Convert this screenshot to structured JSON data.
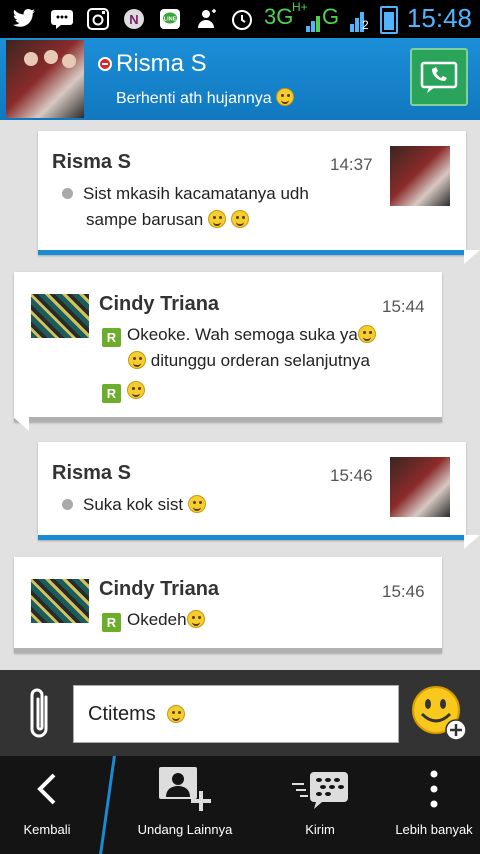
{
  "status_bar": {
    "network_3g": "3G",
    "network_hplus": "H+",
    "network_g": "G",
    "sim_number": "2",
    "time": "15:48",
    "icons": [
      "twitter-icon",
      "bbm-icon",
      "instagram-icon",
      "n-app-icon",
      "line-icon",
      "add-person-icon",
      "alarm-icon",
      "signal-icon",
      "battery-icon"
    ]
  },
  "header": {
    "contact_name": "Risma S",
    "status_message": "Berhenti ath hujannya",
    "presence": "busy",
    "call_button": "call-icon"
  },
  "messages": [
    {
      "sender": "Risma S",
      "time": "14:37",
      "side": "mine",
      "lines": [
        "Sist mkasih kacamatanya udh",
        "sampe barusan"
      ]
    },
    {
      "sender": "Cindy Triana",
      "time": "15:44",
      "side": "theirs",
      "lines": [
        "Okeoke. Wah semoga suka ya",
        "ditunggu orderan selanjutnya"
      ]
    },
    {
      "sender": "Risma S",
      "time": "15:46",
      "side": "mine",
      "lines": [
        "Suka kok sist"
      ]
    },
    {
      "sender": "Cindy Triana",
      "time": "15:46",
      "side": "theirs",
      "lines": [
        "Okedeh"
      ]
    }
  ],
  "read_badge": "R",
  "composer": {
    "value": "Ctitems"
  },
  "bottom_nav": {
    "back": "Kembali",
    "invite_more": "Undang Lainnya",
    "send": "Kirim",
    "more": "Lebih banyak"
  },
  "colors": {
    "header_blue": "#1a85cf",
    "accent_blue": "#1a8ad2",
    "read_green": "#6cad2c",
    "busy_red": "#d9262b",
    "time_blue": "#4fb5ff"
  }
}
